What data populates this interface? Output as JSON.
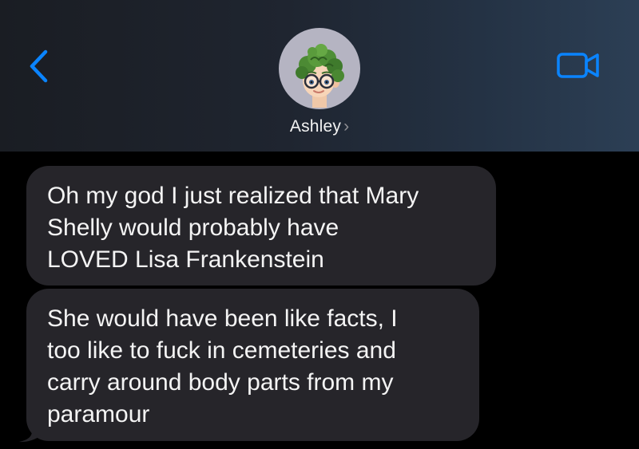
{
  "header": {
    "contact_name": "Ashley",
    "contact_chevron": "›",
    "back_icon": "chevron-left-icon",
    "video_icon": "video-camera-icon",
    "avatar_icon": "memoji-avatar-icon"
  },
  "messages": [
    {
      "direction": "incoming",
      "text": "Oh my god I just realized that Mary\nShelly would probably have\nLOVED Lisa Frankenstein"
    },
    {
      "direction": "incoming",
      "text": "She would have been like facts, I\ntoo like to fuck in cemeteries and\ncarry around body parts from my\nparamour"
    }
  ],
  "colors": {
    "background": "#000000",
    "bubble_incoming": "#26252a",
    "accent_blue": "#0a84ff",
    "name_text": "#f2f2f2"
  }
}
